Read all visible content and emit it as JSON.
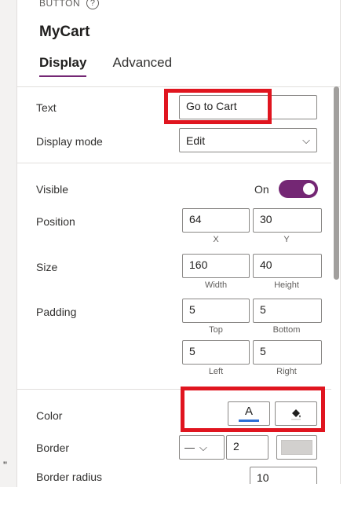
{
  "header": {
    "control_kind": "BUTTON",
    "help_icon": "question-circle-icon",
    "control_name": "MyCart"
  },
  "tabs": [
    {
      "label": "Display",
      "active": true
    },
    {
      "label": "Advanced",
      "active": false
    }
  ],
  "properties": {
    "text": {
      "label": "Text",
      "value": "Go to Cart"
    },
    "display_mode": {
      "label": "Display mode",
      "value": "Edit",
      "icon": "chevron-down-icon"
    },
    "visible": {
      "label": "Visible",
      "state_text": "On",
      "on": true
    },
    "position": {
      "label": "Position",
      "x": "64",
      "y": "30",
      "x_caption": "X",
      "y_caption": "Y"
    },
    "size": {
      "label": "Size",
      "width": "160",
      "height": "40",
      "width_caption": "Width",
      "height_caption": "Height"
    },
    "padding": {
      "label": "Padding",
      "top": "5",
      "bottom": "5",
      "left": "5",
      "right": "5",
      "top_caption": "Top",
      "bottom_caption": "Bottom",
      "left_caption": "Left",
      "right_caption": "Right"
    },
    "color": {
      "label": "Color",
      "font_glyph": "A",
      "font_icon": "font-color-icon",
      "fill_icon": "paint-bucket-icon",
      "font_underline_color": "#2b6fd6"
    },
    "border": {
      "label": "Border",
      "style_glyph": "—",
      "style_icon": "chevron-down-icon",
      "thickness": "2",
      "swatch_color": "#d2d0ce"
    },
    "border_radius": {
      "label": "Border radius",
      "value": "10"
    }
  },
  "canvas": {
    "glyph": "\""
  },
  "colors": {
    "accent": "#742774",
    "highlight": "#e0151f"
  }
}
